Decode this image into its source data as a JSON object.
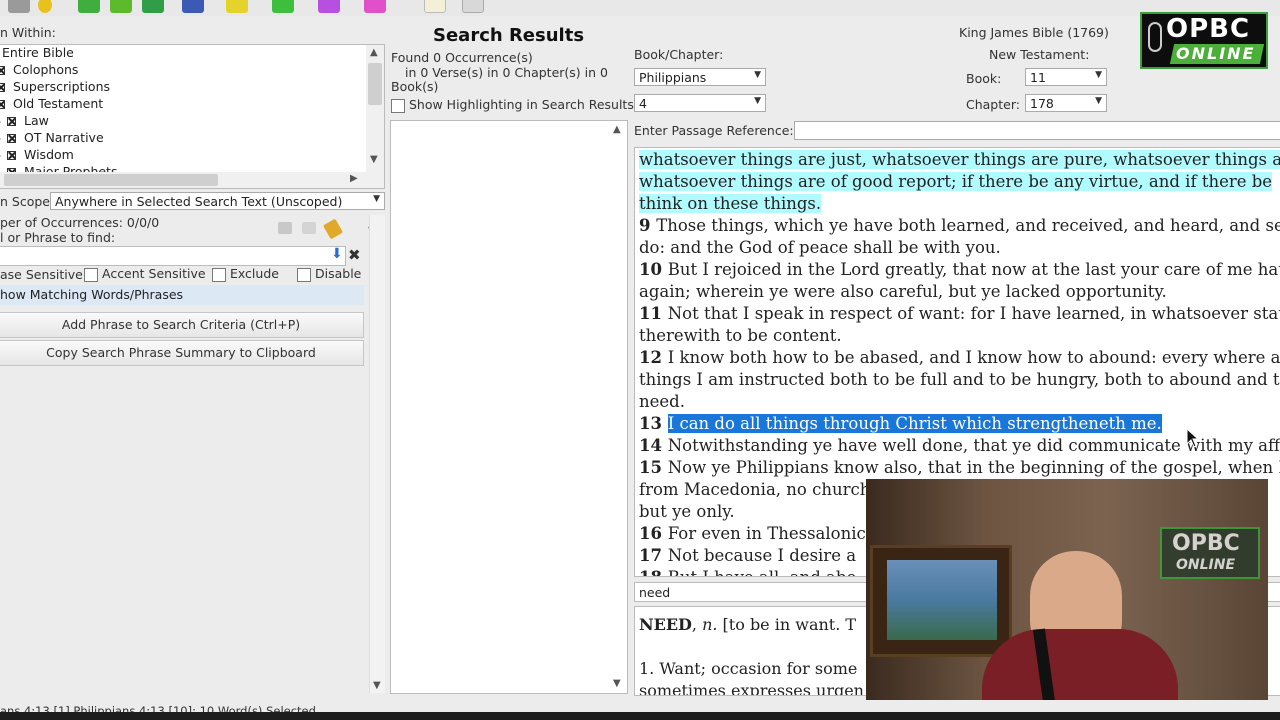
{
  "toolbar": {
    "icons": [
      "arrow-icon",
      "bulb-icon",
      "save-icon",
      "book-green-icon",
      "forward-icon",
      "bible-icon",
      "highlighter-yellow-icon",
      "highlighter-green-icon",
      "highlighter-purple-icon",
      "highlighter-pink-icon",
      "note-icon",
      "print-icon"
    ]
  },
  "search_panel": {
    "search_within_label": "n Within:",
    "tree": [
      {
        "label": "Entire Bible",
        "checked": false,
        "expandable": false
      },
      {
        "label": "Colophons",
        "checked": true,
        "expandable": false
      },
      {
        "label": "Superscriptions",
        "checked": true,
        "expandable": false
      },
      {
        "label": "Old Testament",
        "checked": true,
        "expandable": false
      },
      {
        "label": "Law",
        "checked": true,
        "expandable": true
      },
      {
        "label": "OT Narrative",
        "checked": true,
        "expandable": true
      },
      {
        "label": "Wisdom",
        "checked": true,
        "expandable": true
      },
      {
        "label": "Major Prophets",
        "checked": true,
        "expandable": true
      }
    ],
    "scope_label": "n Scope:",
    "scope_value": "Anywhere in Selected Search Text (Unscoped)",
    "occurrences_label": "per of Occurrences: 0/0/0",
    "phrase_label": "l or Phrase to find:",
    "phrase_value": "",
    "options": [
      {
        "label": "ase Sensitive",
        "checked": false
      },
      {
        "label": "Accent Sensitive",
        "checked": false
      },
      {
        "label": "Exclude",
        "checked": false
      },
      {
        "label": "Disable",
        "checked": false
      }
    ],
    "matching_label": "how Matching Words/Phrases",
    "add_phrase_button": "Add Phrase to Search Criteria (Ctrl+P)",
    "copy_summary_button": "Copy Search Phrase Summary to Clipboard"
  },
  "results_panel": {
    "title": "Search Results",
    "found_line1": "Found 0 Occurrence(s)",
    "found_line2": "in 0 Verse(s) in 0 Chapter(s) in 0",
    "found_line3": "Book(s)",
    "highlight_label": "Show Highlighting in Search Results"
  },
  "passage_panel": {
    "bible_version": "King James Bible (1769)",
    "book_chapter_label": "Book/Chapter:",
    "book_value": "Philippians",
    "chapter_value": "4",
    "testament_label": "New Testament:",
    "book_label": "Book:",
    "book_number": "11",
    "chapter_label": "Chapter:",
    "chapter_number": "178",
    "passage_ref_label": "Enter Passage Reference:",
    "passage_ref_value": "",
    "verses": [
      {
        "num": "",
        "text": "whatsoever things are just, whatsoever things are pure, whatsoever things are",
        "hl": "cyan"
      },
      {
        "num": "",
        "text": "whatsoever things are of good report; if there be any virtue, and if there be",
        "hl": "cyan"
      },
      {
        "num": "",
        "text": "think on these things.",
        "hl": "cyan"
      },
      {
        "num": "9",
        "text": "Those things, which ye have both learned, and received, and heard, and seen",
        "hl": ""
      },
      {
        "num": "",
        "text": "do: and the God of peace shall be with you.",
        "hl": ""
      },
      {
        "num": "10",
        "text": "But I rejoiced in the Lord greatly, that now at the last your care of me hath",
        "hl": ""
      },
      {
        "num": "",
        "text": "again; wherein ye were also careful, but ye lacked opportunity.",
        "hl": ""
      },
      {
        "num": "11",
        "text": "Not that I speak in respect of want: for I have learned, in whatsoever state",
        "hl": ""
      },
      {
        "num": "",
        "text": "therewith to be content.",
        "hl": ""
      },
      {
        "num": "12",
        "text": "I know both how to be abased, and I know how to abound: every where and",
        "hl": ""
      },
      {
        "num": "",
        "text": "things I am instructed both to be full and to be hungry, both to abound and to",
        "hl": ""
      },
      {
        "num": "",
        "text": "need.",
        "hl": ""
      },
      {
        "num": "13",
        "text": "I can do all things through Christ which strengtheneth me.",
        "hl": "sel"
      },
      {
        "num": "14",
        "text": "Notwithstanding ye have well done, that ye did communicate with my affliction",
        "hl": ""
      },
      {
        "num": "15",
        "text": "Now ye Philippians know also, that in the beginning of the gospel, when I",
        "hl": ""
      },
      {
        "num": "",
        "text": "from Macedonia, no church",
        "hl": ""
      },
      {
        "num": "",
        "text": "but ye only.",
        "hl": ""
      },
      {
        "num": "16",
        "text": "For even in Thessalonic",
        "hl": ""
      },
      {
        "num": "17",
        "text": "Not because I desire a",
        "hl": ""
      },
      {
        "num": "18",
        "text": "But I have all, and abo",
        "hl": ""
      }
    ],
    "dictionary_word": "need",
    "dictionary_entry_head": "NEED",
    "dictionary_entry_pos": "n.",
    "dictionary_entry_text": "[to be in want. T",
    "dictionary_line2": "1. Want; occasion for some",
    "dictionary_line3": "sometimes expresses urgen"
  },
  "logo": {
    "line1": "OPBC",
    "line2": "ONLINE"
  },
  "status": {
    "text": "ans 4:13 [1]  Philippians 4:13 [10]: 10 Word(s) Selected"
  },
  "colors": {
    "cyan_highlight": "#b0fbff",
    "selection": "#1877d8"
  }
}
